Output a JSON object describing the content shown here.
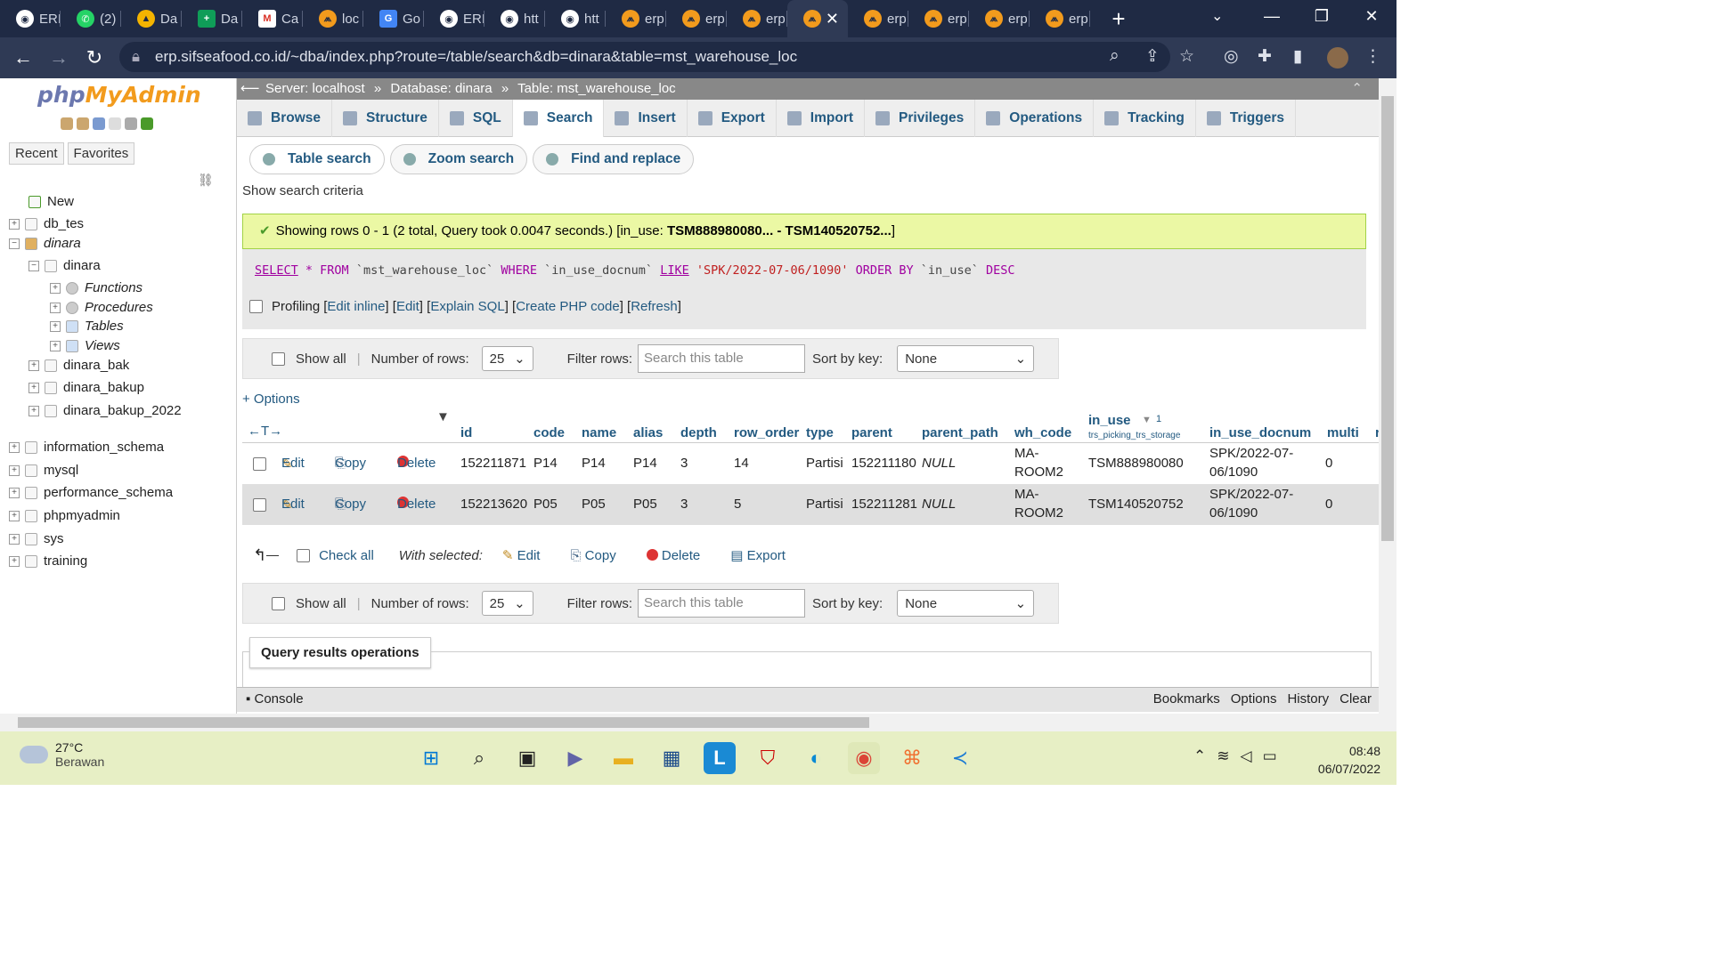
{
  "browser": {
    "tabs": [
      {
        "label": "ERI"
      },
      {
        "label": "(2)"
      },
      {
        "label": "Da"
      },
      {
        "label": "Da"
      },
      {
        "label": "Ca"
      },
      {
        "label": "loc"
      },
      {
        "label": "Go"
      },
      {
        "label": "ERI"
      },
      {
        "label": "htt"
      },
      {
        "label": "htt"
      },
      {
        "label": "erp"
      },
      {
        "label": "erp"
      },
      {
        "label": "erp"
      },
      {
        "label": ""
      },
      {
        "label": "erp"
      },
      {
        "label": "erp"
      },
      {
        "label": "erp"
      },
      {
        "label": "erp"
      }
    ],
    "url": "erp.sifseafood.co.id/~dba/index.php?route=/table/search&db=dinara&table=mst_warehouse_loc"
  },
  "sidebar": {
    "logo_php": "php",
    "logo_my": "MyAdmin",
    "recent": "Recent",
    "favorites": "Favorites",
    "tree": [
      {
        "label": "New"
      },
      {
        "label": "db_tes"
      },
      {
        "label": "dinara"
      },
      {
        "label": "dinara"
      },
      {
        "label": "Functions"
      },
      {
        "label": "Procedures"
      },
      {
        "label": "Tables"
      },
      {
        "label": "Views"
      },
      {
        "label": "dinara_bak"
      },
      {
        "label": "dinara_bakup"
      },
      {
        "label": "dinara_bakup_2022"
      },
      {
        "label": "information_schema"
      },
      {
        "label": "mysql"
      },
      {
        "label": "performance_schema"
      },
      {
        "label": "phpmyadmin"
      },
      {
        "label": "sys"
      },
      {
        "label": "training"
      }
    ]
  },
  "breadcrumb": {
    "server": "Server: localhost",
    "database": "Database: dinara",
    "table": "Table: mst_warehouse_loc",
    "sep": "»"
  },
  "menu_tabs": [
    "Browse",
    "Structure",
    "SQL",
    "Search",
    "Insert",
    "Export",
    "Import",
    "Privileges",
    "Operations",
    "Tracking",
    "Triggers"
  ],
  "sub_tabs": [
    "Table search",
    "Zoom search",
    "Find and replace"
  ],
  "show_criteria": "Show search criteria",
  "success": {
    "text": "Showing rows 0 - 1 (2 total, Query took 0.0047 seconds.) [in_use: ",
    "range": "TSM888980080... - TSM140520752...",
    "close": "]"
  },
  "sql": {
    "select": "SELECT",
    "star": " * ",
    "from": "FROM",
    "table": " `mst_warehouse_loc` ",
    "where": "WHERE",
    "col": " `in_use_docnum` ",
    "like": "LIKE",
    "val": " 'SPK/2022-07-06/1090' ",
    "order": "ORDER BY",
    "col2": " `in_use` ",
    "desc": "DESC"
  },
  "profiling": {
    "label": "Profiling",
    "links": [
      "Edit inline",
      "Edit",
      "Explain SQL",
      "Create PHP code",
      "Refresh"
    ]
  },
  "nav": {
    "show_all": "Show all",
    "num_rows_label": "Number of rows:",
    "num_rows": "25",
    "filter_label": "Filter rows:",
    "filter_placeholder": "Search this table",
    "sort_label": "Sort by key:",
    "sort_value": "None"
  },
  "options_link": "+ Options",
  "columns": [
    "id",
    "code",
    "name",
    "alias",
    "depth",
    "row_order",
    "type",
    "parent",
    "parent_path",
    "wh_code",
    "in_use",
    "in_use_docnum",
    "multi",
    "r"
  ],
  "in_use_sub": "trs_picking_trs_storage",
  "in_use_sort": "1",
  "row_actions": {
    "edit": "Edit",
    "copy": "Copy",
    "delete": "Delete"
  },
  "rows": [
    {
      "id": "152211871",
      "code": "P14",
      "name": "P14",
      "alias": "P14",
      "depth": "3",
      "row_order": "14",
      "type": "Partisi",
      "parent": "152211180",
      "parent_path": "NULL",
      "wh_code_1": "MA-",
      "wh_code_2": "ROOM2",
      "in_use": "TSM888980080",
      "docnum_1": "SPK/2022-07-",
      "docnum_2": "06/1090",
      "multi": "0"
    },
    {
      "id": "152213620",
      "code": "P05",
      "name": "P05",
      "alias": "P05",
      "depth": "3",
      "row_order": "5",
      "type": "Partisi",
      "parent": "152211281",
      "parent_path": "NULL",
      "wh_code_1": "MA-",
      "wh_code_2": "ROOM2",
      "in_use": "TSM140520752",
      "docnum_1": "SPK/2022-07-",
      "docnum_2": "06/1090",
      "multi": "0"
    }
  ],
  "bulk": {
    "check_all": "Check all",
    "with_selected": "With selected:",
    "edit": "Edit",
    "copy": "Copy",
    "delete": "Delete",
    "export": "Export"
  },
  "query_ops": "Query results operations",
  "console": {
    "label": "Console",
    "links": [
      "Bookmarks",
      "Options",
      "History",
      "Clear"
    ]
  },
  "taskbar": {
    "temp": "27°C",
    "weather": "Berawan",
    "time": "08:48",
    "date": "06/07/2022"
  },
  "colors": {
    "link": "#235a81",
    "success_bg": "#ebf8a4",
    "taskbar_bg": "#e7efc5",
    "browser_bg": "#1f2a44"
  }
}
